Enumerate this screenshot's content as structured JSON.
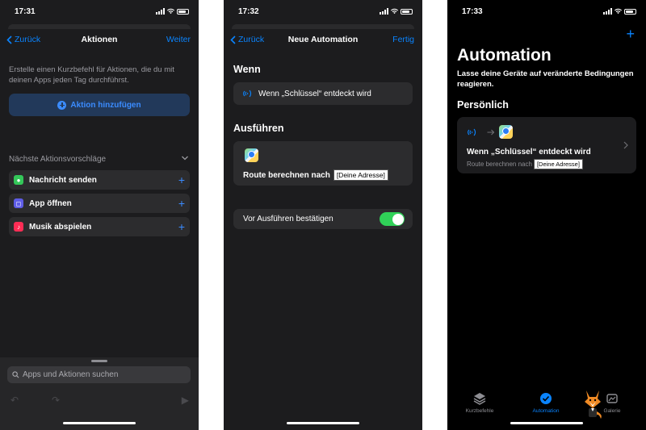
{
  "screens": [
    {
      "status_time": "17:31",
      "nav": {
        "back_label": "Zurück",
        "title": "Aktionen",
        "right_label": "Weiter"
      },
      "intro_text": "Erstelle einen Kurzbefehl für Aktionen, die du mit deinen Apps jeden Tag durchführst.",
      "add_action_label": "Aktion hinzufügen",
      "suggestions_title": "Nächste Aktionsvorschläge",
      "suggestions": [
        {
          "label": "Nachricht senden",
          "icon": "messages-icon",
          "color": "#34c759"
        },
        {
          "label": "App öffnen",
          "icon": "app-icon",
          "color": "#5e5ce6"
        },
        {
          "label": "Musik abspielen",
          "icon": "music-icon",
          "color": "#ff2d55"
        }
      ],
      "search_placeholder": "Apps und Aktionen suchen"
    },
    {
      "status_time": "17:32",
      "nav": {
        "back_label": "Zurück",
        "title": "Neue Automation",
        "right_label": "Fertig"
      },
      "when_title": "Wenn",
      "trigger_text": "Wenn „Schlüssel“ entdeckt wird",
      "do_title": "Ausführen",
      "action_text": "Route berechnen nach",
      "action_token": "[Deine Adresse]",
      "confirm_label": "Vor Ausführen bestätigen",
      "confirm_enabled": true
    },
    {
      "status_time": "17:33",
      "title": "Automation",
      "subtitle": "Lasse deine Geräte auf veränderte Bedingungen reagieren.",
      "section_title": "Persönlich",
      "automation": {
        "title": "Wenn „Schlüssel“ entdeckt wird",
        "subtitle": "Route berechnen nach",
        "token": "[Deine Adresse]"
      },
      "tabs": [
        {
          "label": "Kurzbefehle",
          "icon": "layers-icon",
          "active": false
        },
        {
          "label": "Automation",
          "icon": "clock-check-icon",
          "active": true
        },
        {
          "label": "Galerie",
          "icon": "gallery-icon",
          "active": false
        }
      ]
    }
  ],
  "colors": {
    "accent": "#0a84ff",
    "toggle_on": "#30d158",
    "background": "#1c1c1e"
  }
}
